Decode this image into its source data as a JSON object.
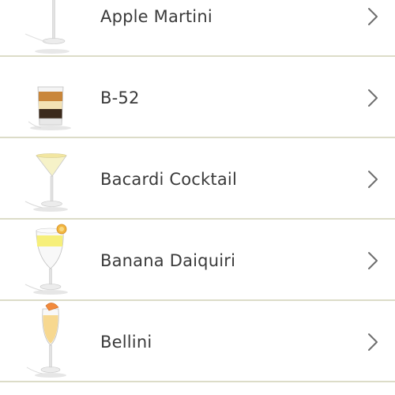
{
  "cocktail_list": {
    "items": [
      {
        "name": "Apple Martini",
        "icon": "apple-martini-glass-icon"
      },
      {
        "name": "B-52",
        "icon": "b52-shot-glass-icon"
      },
      {
        "name": "Bacardi Cocktail",
        "icon": "bacardi-cocktail-glass-icon"
      },
      {
        "name": "Banana Daiquiri",
        "icon": "banana-daiquiri-glass-icon"
      },
      {
        "name": "Bellini",
        "icon": "bellini-flute-glass-icon"
      }
    ],
    "chevron_icon": "chevron-right-icon"
  },
  "colors": {
    "divider": "#dcdcc8",
    "text": "#3a3a3a",
    "chevron": "#6e6e6e"
  }
}
